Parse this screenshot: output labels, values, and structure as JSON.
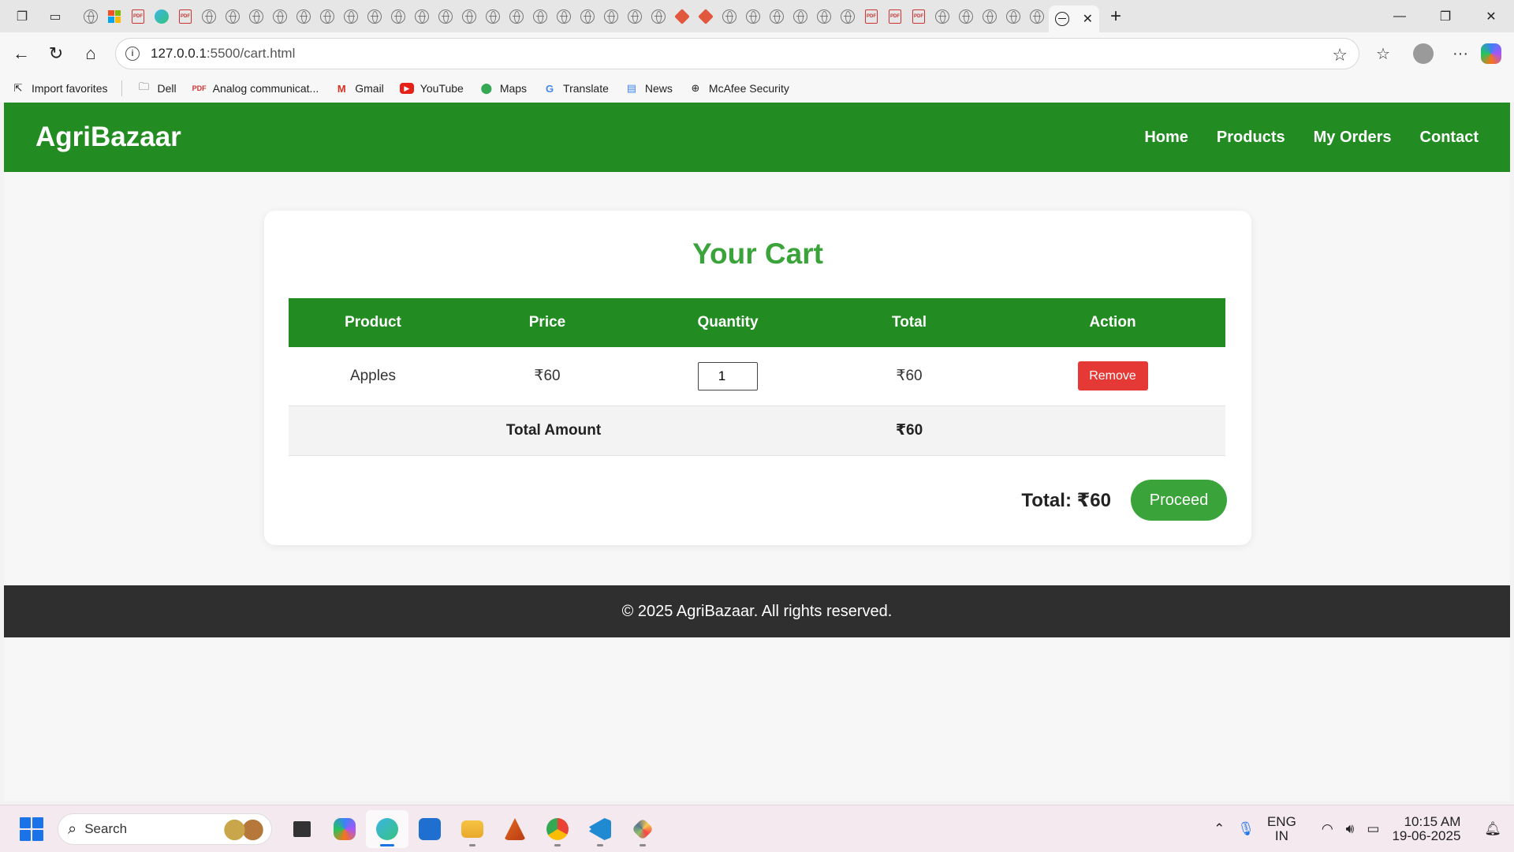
{
  "browser": {
    "active_tab_close": "✕",
    "new_tab": "+",
    "url_host": "127.0.0.1",
    "url_path": ":5500/cart.html",
    "favorites": [
      {
        "label": "Import favorites",
        "icon": "import-icon"
      },
      {
        "label": "Dell",
        "icon": "folder-icon"
      },
      {
        "label": "Analog communicat...",
        "icon": "pdf-icon"
      },
      {
        "label": "Gmail",
        "icon": "gmail-icon"
      },
      {
        "label": "YouTube",
        "icon": "youtube-icon"
      },
      {
        "label": "Maps",
        "icon": "maps-icon"
      },
      {
        "label": "Translate",
        "icon": "translate-icon"
      },
      {
        "label": "News",
        "icon": "news-icon"
      },
      {
        "label": "McAfee Security",
        "icon": "globe-icon"
      }
    ]
  },
  "site": {
    "brand": "AgriBazaar",
    "nav": [
      "Home",
      "Products",
      "My Orders",
      "Contact"
    ],
    "colors": {
      "header": "#228b22",
      "accent": "#3aa33a",
      "danger": "#e53935",
      "footer": "#2f2f2f"
    }
  },
  "cart": {
    "title": "Your Cart",
    "columns": [
      "Product",
      "Price",
      "Quantity",
      "Total",
      "Action"
    ],
    "items": [
      {
        "product": "Apples",
        "price": "₹60",
        "quantity": "1",
        "total": "₹60",
        "action": "Remove"
      }
    ],
    "total_label": "Total Amount",
    "total_value": "₹60",
    "summary_total": "Total: ₹60",
    "proceed_label": "Proceed"
  },
  "footer": {
    "text": "© 2025 AgriBazaar. All rights reserved."
  },
  "taskbar": {
    "search_label": "Search",
    "lang_line1": "ENG",
    "lang_line2": "IN",
    "time": "10:15 AM",
    "date": "19-06-2025"
  }
}
